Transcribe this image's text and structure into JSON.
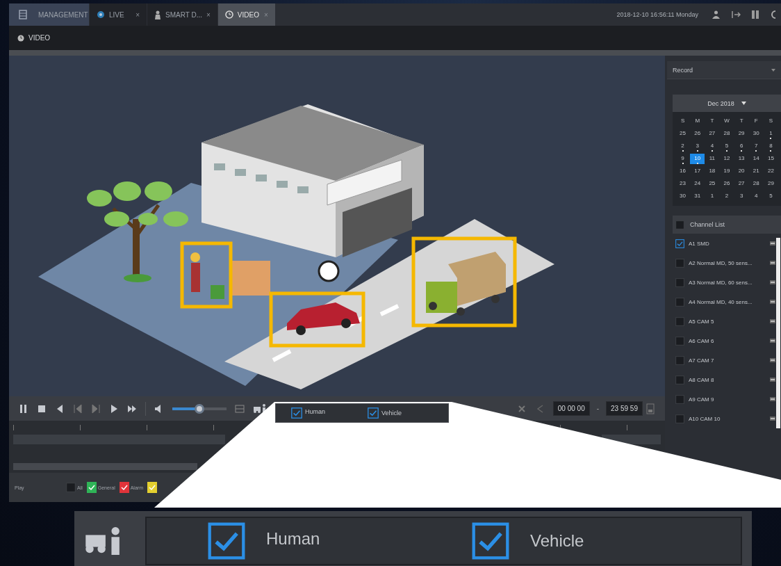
{
  "tabs": [
    {
      "label": "MANAGEMENT",
      "kind": "home",
      "selected": false
    },
    {
      "label": "LIVE",
      "kind": "page",
      "selected": false,
      "close": "×"
    },
    {
      "label": "SMART D...",
      "kind": "page",
      "selected": false,
      "close": "×"
    },
    {
      "label": "VIDEO",
      "kind": "page",
      "selected": true,
      "close": "×"
    }
  ],
  "datetime": "2018-12-10 16:56:11 Monday",
  "page_header": {
    "title": "VIDEO"
  },
  "side_panel": {
    "record_type": "Record",
    "calendar": {
      "month": "Dec 2018",
      "weekdays": [
        "S",
        "M",
        "T",
        "W",
        "T",
        "F",
        "S"
      ],
      "days": [
        {
          "label": "25",
          "selected": false,
          "has_record": false
        },
        {
          "label": "26",
          "selected": false,
          "has_record": false
        },
        {
          "label": "27",
          "selected": false,
          "has_record": false
        },
        {
          "label": "28",
          "selected": false,
          "has_record": false
        },
        {
          "label": "29",
          "selected": false,
          "has_record": false
        },
        {
          "label": "30",
          "selected": false,
          "has_record": false
        },
        {
          "label": "1",
          "selected": false,
          "has_record": true
        },
        {
          "label": "2",
          "selected": false,
          "has_record": true
        },
        {
          "label": "3",
          "selected": false,
          "has_record": true
        },
        {
          "label": "4",
          "selected": false,
          "has_record": true
        },
        {
          "label": "5",
          "selected": false,
          "has_record": true
        },
        {
          "label": "6",
          "selected": false,
          "has_record": true
        },
        {
          "label": "7",
          "selected": false,
          "has_record": true
        },
        {
          "label": "8",
          "selected": false,
          "has_record": true
        },
        {
          "label": "9",
          "selected": false,
          "has_record": true
        },
        {
          "label": "10",
          "selected": true,
          "has_record": true
        },
        {
          "label": "11",
          "selected": false,
          "has_record": false
        },
        {
          "label": "12",
          "selected": false,
          "has_record": false
        },
        {
          "label": "13",
          "selected": false,
          "has_record": false
        },
        {
          "label": "14",
          "selected": false,
          "has_record": false
        },
        {
          "label": "15",
          "selected": false,
          "has_record": false
        },
        {
          "label": "16",
          "selected": false,
          "has_record": false
        },
        {
          "label": "17",
          "selected": false,
          "has_record": false
        },
        {
          "label": "18",
          "selected": false,
          "has_record": false
        },
        {
          "label": "19",
          "selected": false,
          "has_record": false
        },
        {
          "label": "20",
          "selected": false,
          "has_record": false
        },
        {
          "label": "21",
          "selected": false,
          "has_record": false
        },
        {
          "label": "22",
          "selected": false,
          "has_record": false
        },
        {
          "label": "23",
          "selected": false,
          "has_record": false
        },
        {
          "label": "24",
          "selected": false,
          "has_record": false
        },
        {
          "label": "25",
          "selected": false,
          "has_record": false
        },
        {
          "label": "26",
          "selected": false,
          "has_record": false
        },
        {
          "label": "27",
          "selected": false,
          "has_record": false
        },
        {
          "label": "28",
          "selected": false,
          "has_record": false
        },
        {
          "label": "29",
          "selected": false,
          "has_record": false
        },
        {
          "label": "30",
          "selected": false,
          "has_record": false
        },
        {
          "label": "31",
          "selected": false,
          "has_record": false
        },
        {
          "label": "1",
          "selected": false,
          "has_record": false
        },
        {
          "label": "2",
          "selected": false,
          "has_record": false
        },
        {
          "label": "3",
          "selected": false,
          "has_record": false
        },
        {
          "label": "4",
          "selected": false,
          "has_record": false
        },
        {
          "label": "5",
          "selected": false,
          "has_record": false
        }
      ]
    },
    "channel_list": {
      "title": "Channel List",
      "checked": false,
      "channels": [
        {
          "name": "A1 SMD",
          "checked": true
        },
        {
          "name": "A2 Normal MD, 50 sens...",
          "checked": false
        },
        {
          "name": "A3 Normal MD, 60 sens...",
          "checked": false
        },
        {
          "name": "A4 Normal MD, 40 sens...",
          "checked": false
        },
        {
          "name": "A5 CAM 5",
          "checked": false
        },
        {
          "name": "A6 CAM 6",
          "checked": false
        },
        {
          "name": "A7 CAM 7",
          "checked": false
        },
        {
          "name": "A8 CAM 8",
          "checked": false
        },
        {
          "name": "A9 CAM 9",
          "checked": false
        },
        {
          "name": "A10 CAM 10",
          "checked": false
        }
      ]
    }
  },
  "playback": {
    "volume": {
      "level": 0.5
    },
    "filters": [
      {
        "label": "Human",
        "checked": true
      },
      {
        "label": "Vehicle",
        "checked": true
      }
    ],
    "time_start": "00 00 00",
    "time_separator": "-",
    "time_end": "23 59 59"
  },
  "legend": {
    "play_label": "Play",
    "all": {
      "label": "All",
      "checked": false
    },
    "items": [
      {
        "label": "General",
        "color": "#2fb457",
        "checked": true
      },
      {
        "label": "Alarm",
        "color": "#e0343a",
        "checked": true
      },
      {
        "color": "#e3cf2f",
        "checked": true
      }
    ]
  },
  "zoom_callout": {
    "filters": [
      {
        "label": "Human",
        "checked": true
      },
      {
        "label": "Vehicle",
        "checked": true
      }
    ]
  }
}
